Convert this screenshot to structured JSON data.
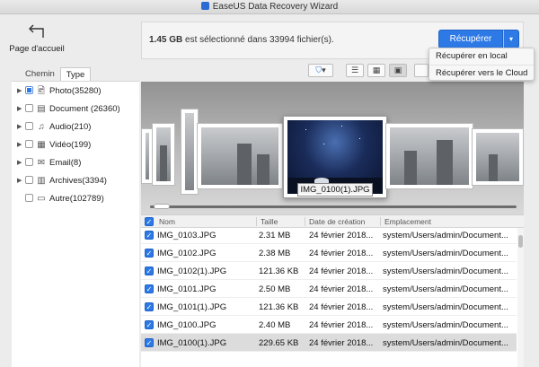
{
  "window": {
    "title": "EaseUS Data Recovery Wizard"
  },
  "home": {
    "label": "Page d'accueil"
  },
  "selection": {
    "size": "1.45 GB",
    "text": "est sélectionné dans 33994 fichier(s)."
  },
  "recover": {
    "button_label": "Récupérer",
    "arrow": "▾",
    "options": [
      "Récupérer en local",
      "Récupérer vers le Cloud"
    ]
  },
  "tabs": [
    "Chemin",
    "Type"
  ],
  "tree": [
    {
      "label": "Photo(35280)",
      "icon": "image-file-icon",
      "glyph": "🖻",
      "has_children": true,
      "checked": "partial"
    },
    {
      "label": "Document (26360)",
      "icon": "document-icon",
      "glyph": "▤",
      "has_children": true,
      "checked": "none"
    },
    {
      "label": "Audio(210)",
      "icon": "music-note-icon",
      "glyph": "♫",
      "has_children": true,
      "checked": "none"
    },
    {
      "label": "Vidéo(199)",
      "icon": "video-icon",
      "glyph": "▦",
      "has_children": true,
      "checked": "none"
    },
    {
      "label": "Email(8)",
      "icon": "envelope-icon",
      "glyph": "✉",
      "has_children": true,
      "checked": "none"
    },
    {
      "label": "Archives(3394)",
      "icon": "archive-icon",
      "glyph": "▥",
      "has_children": true,
      "checked": "none"
    },
    {
      "label": "Autre(102789)",
      "icon": "folder-icon",
      "glyph": "▭",
      "has_children": false,
      "checked": "none"
    }
  ],
  "gallery": {
    "caption": "IMG_0100(1).JPG"
  },
  "table": {
    "headers": [
      "Nom",
      "Taille",
      "Date de création",
      "Emplacement"
    ],
    "rows": [
      {
        "name": "IMG_0103.JPG",
        "size": "2.31 MB",
        "date": "24 février 2018...",
        "location": "system/Users/admin/Document..."
      },
      {
        "name": "IMG_0102.JPG",
        "size": "2.38 MB",
        "date": "24 février 2018...",
        "location": "system/Users/admin/Document..."
      },
      {
        "name": "IMG_0102(1).JPG",
        "size": "121.36 KB",
        "date": "24 février 2018...",
        "location": "system/Users/admin/Document..."
      },
      {
        "name": "IMG_0101.JPG",
        "size": "2.50 MB",
        "date": "24 février 2018...",
        "location": "system/Users/admin/Document..."
      },
      {
        "name": "IMG_0101(1).JPG",
        "size": "121.36 KB",
        "date": "24 février 2018...",
        "location": "system/Users/admin/Document..."
      },
      {
        "name": "IMG_0100.JPG",
        "size": "2.40 MB",
        "date": "24 février 2018...",
        "location": "system/Users/admin/Document..."
      },
      {
        "name": "IMG_0100(1).JPG",
        "size": "229.65 KB",
        "date": "24 février 2018...",
        "location": "system/Users/admin/Document...",
        "selected": true
      }
    ]
  },
  "colors": {
    "accent": "#2d7ae6",
    "selected_row": "#dcdcdc"
  }
}
